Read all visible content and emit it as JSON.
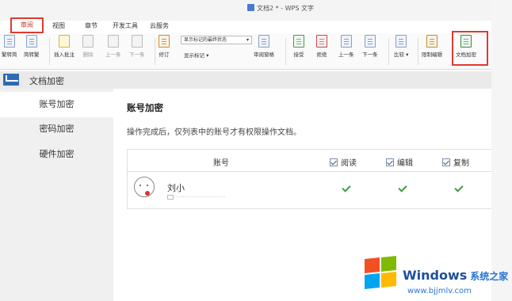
{
  "window": {
    "title": "文档2 * - WPS 文字"
  },
  "menu_tabs": [
    {
      "label": "审阅",
      "active": true
    },
    {
      "label": "视图"
    },
    {
      "label": "章节"
    },
    {
      "label": "开发工具"
    },
    {
      "label": "云服务"
    }
  ],
  "ribbon": {
    "trad_to_simp": "繁转简",
    "simp_to_trad": "简转繁",
    "insert_comment": "插入批注",
    "delete": "删除",
    "prev_comment": "上一条",
    "next_comment": "下一条",
    "revise": "修订",
    "markup_select": "显示标记的最终状态",
    "show_markup": "显示标记",
    "review_pane": "审阅窗格",
    "accept": "接受",
    "reject": "拒绝",
    "prev_change": "上一条",
    "next_change": "下一条",
    "compare": "比较",
    "restrict_edit": "限制编辑",
    "doc_encrypt": "文档加密"
  },
  "panel": {
    "title": "文档加密"
  },
  "sidebar": {
    "items": [
      {
        "label": "账号加密",
        "active": true
      },
      {
        "label": "密码加密"
      },
      {
        "label": "硬件加密"
      }
    ]
  },
  "main": {
    "title": "账号加密",
    "description": "操作完成后，仅列表中的账号才有权限操作文档。",
    "table": {
      "col_account": "账号",
      "col_read": "阅读",
      "col_edit": "编辑",
      "col_copy": "复制",
      "rows": [
        {
          "name": "刘小",
          "email": "·······················",
          "read": true,
          "edit": true,
          "copy": true
        }
      ]
    }
  },
  "watermark": {
    "brand": "Windows",
    "brand_cn": "系统之家",
    "url": "www.bjjmlv.com"
  },
  "colors": {
    "highlight": "#e03a2f",
    "accent": "#2d6bb5",
    "check": "#3f9e3f"
  }
}
